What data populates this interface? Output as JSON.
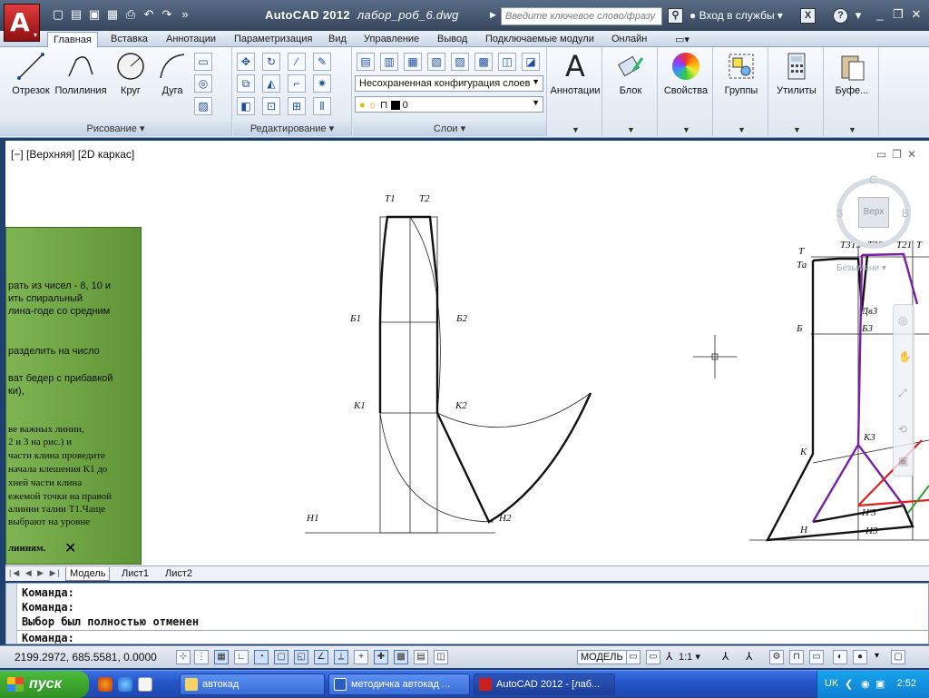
{
  "titlebar": {
    "app_name": "AutoCAD 2012",
    "document": "лабор_роб_6.dwg",
    "search_placeholder": "Введите ключевое слово/фразу",
    "login": "Вход в службы"
  },
  "ribbon_tabs": [
    "Главная",
    "Вставка",
    "Аннотации",
    "Параметризация",
    "Вид",
    "Управление",
    "Вывод",
    "Подключаемые модули",
    "Онлайн"
  ],
  "draw_panel": {
    "title": "Рисование",
    "tools": [
      "Отрезок",
      "Полилиния",
      "Круг",
      "Дуга"
    ]
  },
  "modify_panel": {
    "title": "Редактирование"
  },
  "layers_panel": {
    "title": "Слои",
    "layer_state": "Несохраненная конфигурация слоев",
    "current_layer": "0"
  },
  "big_tools": [
    "Аннотации",
    "Блок",
    "Свойства",
    "Группы",
    "Утилиты",
    "Буфе..."
  ],
  "viewport": {
    "label": "[−] [Верхняя] [2D каркас]",
    "viewcube": {
      "north": "С",
      "west": "З",
      "east": "В",
      "face": "Верх",
      "ucs": "Безымяни"
    }
  },
  "overlay_text": [
    "рать из чисел - 8, 10 и",
    "ить спиральный",
    "лина-годе со средним",
    "разделить на число",
    "ват бедер с прибавкой",
    "ки),",
    "ве важных линии,",
    "2 и 3 на рис.) и",
    "части клина проведите",
    "начала клешения К1 до",
    "хней части клина",
    "ежемой точки на правой",
    "алинии талии Т1.Чаще",
    "выбрают на уровне",
    "линиям."
  ],
  "drawing_labels": {
    "left": [
      "Т1",
      "Т2",
      "Б1",
      "Б2",
      "К1",
      "К2",
      "Н1",
      "Н2"
    ],
    "right": [
      "Т",
      "Та",
      "Т3Т3",
      "Т32",
      "Т21",
      "Т",
      "Дв3",
      "Б",
      "Б3",
      "К",
      "К3",
      "Н",
      "Н'3",
      "Н3"
    ]
  },
  "layout_tabs": [
    "Модель",
    "Лист1",
    "Лист2"
  ],
  "command_history": [
    "Команда:",
    "Команда:",
    "Выбор был полностью отменен"
  ],
  "command_prompt": "Команда:",
  "status": {
    "coordinates": "2199.2972, 685.5581, 0.0000",
    "space": "МОДЕЛЬ",
    "scale": "1:1"
  },
  "taskbar": {
    "start": "пуск",
    "tasks": [
      "автокад",
      "методичка автокад ...",
      "AutoCAD 2012 - [лаб..."
    ],
    "lang": "UK",
    "clock": "2:52"
  },
  "colors": {
    "accent": "#2556c9",
    "purple": "#7a1fa8",
    "red": "#e02020",
    "green": "#2fa02f"
  }
}
